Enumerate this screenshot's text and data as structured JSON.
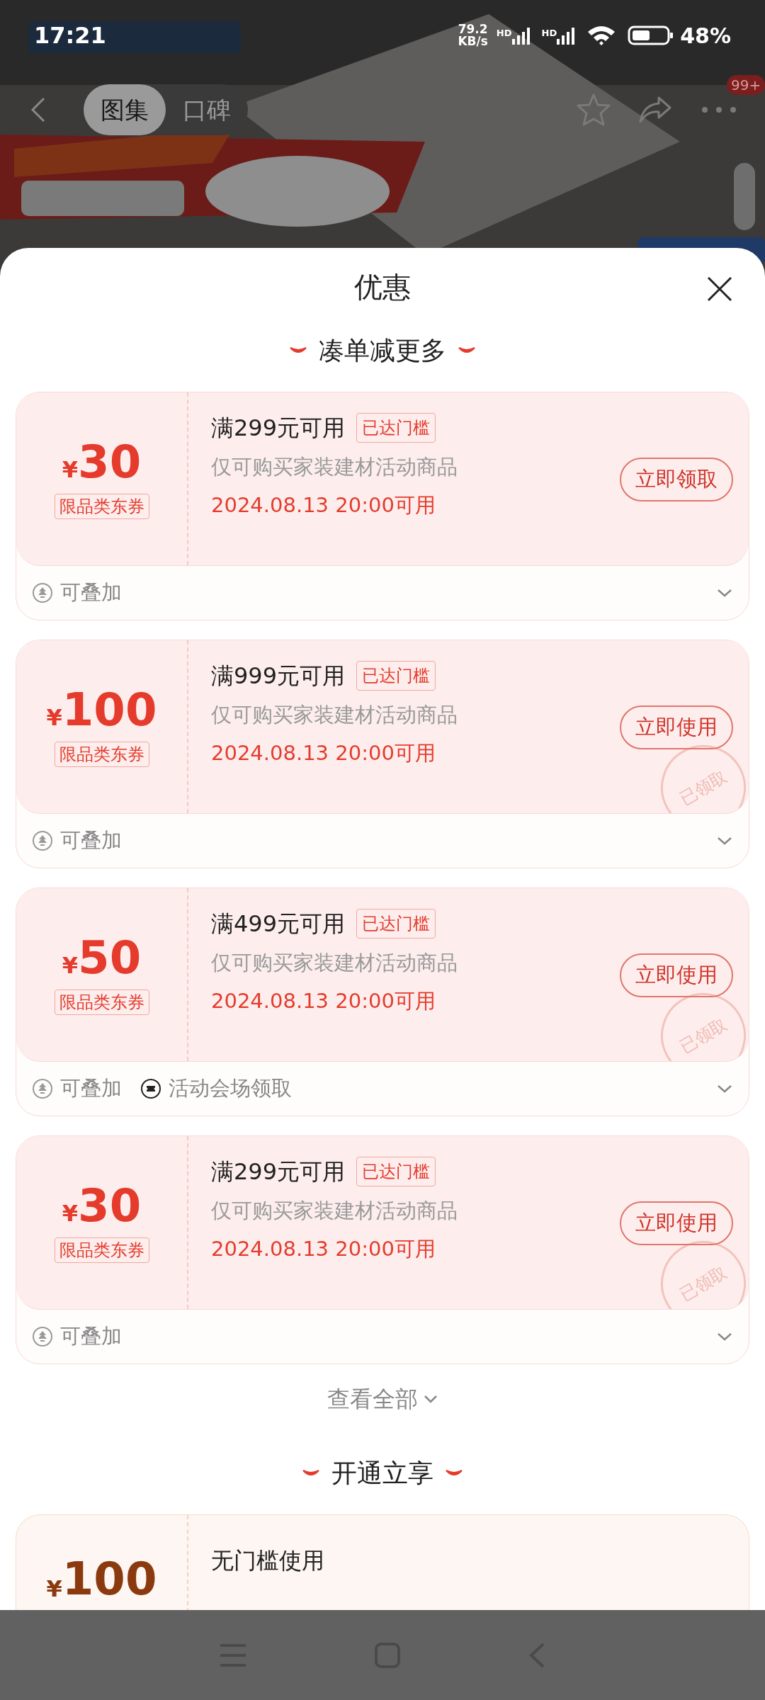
{
  "status_bar": {
    "time": "17:21",
    "speed_value": "79.2",
    "speed_unit": "KB/s",
    "network_labels": [
      "HD",
      "HD"
    ],
    "battery": "48%"
  },
  "header": {
    "kind": "picture",
    "tabs": [
      {
        "label": "图集",
        "selected": true
      },
      {
        "label": "口碑",
        "selected": false
      }
    ],
    "more_badge": "99+"
  },
  "sheet": {
    "title": "优惠",
    "sections": [
      {
        "title": "凑单减更多",
        "coupons": [
          {
            "amount": "30",
            "currency": "¥",
            "badge": "限品类东券",
            "condition": "满299元可用",
            "threshold": "已达门槛",
            "scope": "仅可购买家装建材活动商品",
            "date": "2024.08.13 20:00可用",
            "button": "立即领取",
            "claimed": false,
            "tags": [
              {
                "kind": "stack",
                "text": "可叠加"
              }
            ]
          },
          {
            "amount": "100",
            "currency": "¥",
            "badge": "限品类东券",
            "condition": "满999元可用",
            "threshold": "已达门槛",
            "scope": "仅可购买家装建材活动商品",
            "date": "2024.08.13 20:00可用",
            "button": "立即使用",
            "claimed": true,
            "stamp": "已领取",
            "tags": [
              {
                "kind": "stack",
                "text": "可叠加"
              }
            ]
          },
          {
            "amount": "50",
            "currency": "¥",
            "badge": "限品类东券",
            "condition": "满499元可用",
            "threshold": "已达门槛",
            "scope": "仅可购买家装建材活动商品",
            "date": "2024.08.13 20:00可用",
            "button": "立即使用",
            "claimed": true,
            "stamp": "已领取",
            "tags": [
              {
                "kind": "stack",
                "text": "可叠加"
              },
              {
                "kind": "venue",
                "text": "活动会场领取"
              }
            ]
          },
          {
            "amount": "30",
            "currency": "¥",
            "badge": "限品类东券",
            "condition": "满299元可用",
            "threshold": "已达门槛",
            "scope": "仅可购买家装建材活动商品",
            "date": "2024.08.13 20:00可用",
            "button": "立即使用",
            "claimed": true,
            "stamp": "已领取",
            "tags": [
              {
                "kind": "stack",
                "text": "可叠加"
              }
            ]
          }
        ],
        "view_all": "查看全部"
      },
      {
        "title": "开通立享",
        "coupons": [
          {
            "amount": "100",
            "currency": "¥",
            "condition": "无门槛使用"
          }
        ]
      }
    ]
  }
}
